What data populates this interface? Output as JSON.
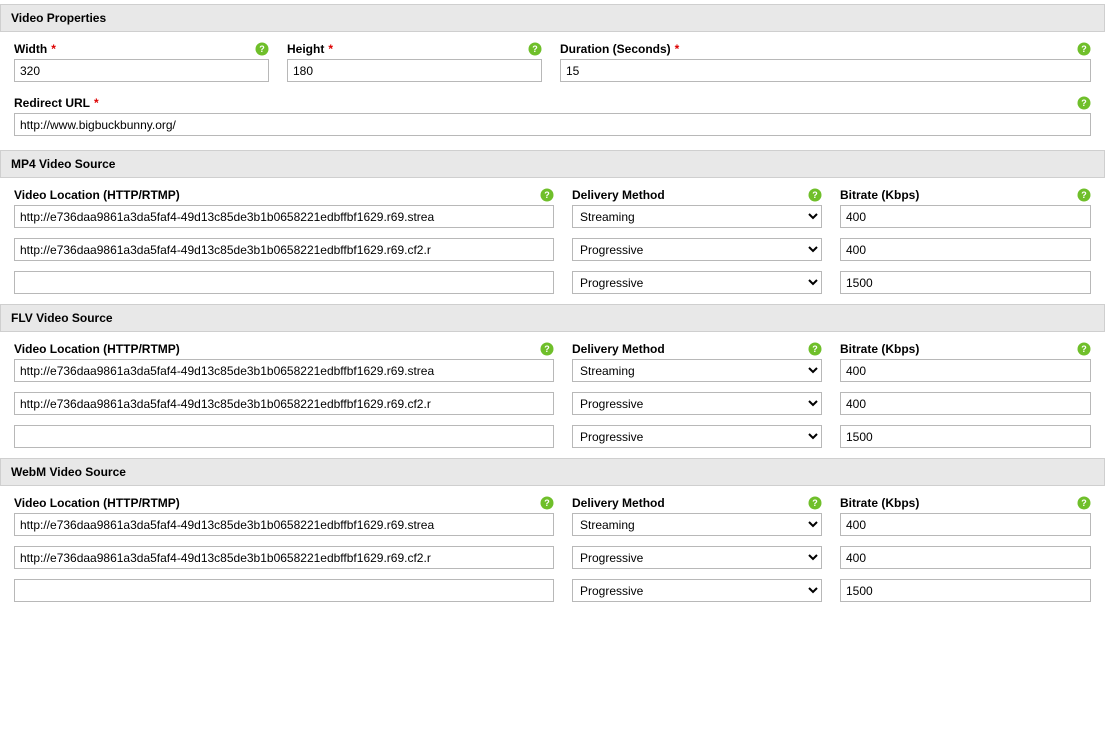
{
  "icons": {
    "help": "help-icon"
  },
  "sections": {
    "video_properties": {
      "title": "Video Properties",
      "width": {
        "label": "Width",
        "required": true,
        "value": "320"
      },
      "height": {
        "label": "Height",
        "required": true,
        "value": "180"
      },
      "duration": {
        "label": "Duration (Seconds)",
        "required": true,
        "value": "15"
      },
      "redirect": {
        "label": "Redirect URL",
        "required": true,
        "value": "http://www.bigbuckbunny.org/"
      }
    },
    "mp4": {
      "title": "MP4 Video Source"
    },
    "flv": {
      "title": "FLV Video Source"
    },
    "webm": {
      "title": "WebM Video Source"
    }
  },
  "source_labels": {
    "location": "Video Location (HTTP/RTMP)",
    "method": "Delivery Method",
    "bitrate": "Bitrate (Kbps)"
  },
  "delivery_options": [
    "Streaming",
    "Progressive"
  ],
  "source_rows": {
    "mp4": [
      {
        "location": "http://e736daa9861a3da5faf4-49d13c85de3b1b0658221edbffbf1629.r69.strea",
        "method": "Streaming",
        "bitrate": "400"
      },
      {
        "location": "http://e736daa9861a3da5faf4-49d13c85de3b1b0658221edbffbf1629.r69.cf2.r",
        "method": "Progressive",
        "bitrate": "400"
      },
      {
        "location": "",
        "method": "Progressive",
        "bitrate": "1500"
      }
    ],
    "flv": [
      {
        "location": "http://e736daa9861a3da5faf4-49d13c85de3b1b0658221edbffbf1629.r69.strea",
        "method": "Streaming",
        "bitrate": "400"
      },
      {
        "location": "http://e736daa9861a3da5faf4-49d13c85de3b1b0658221edbffbf1629.r69.cf2.r",
        "method": "Progressive",
        "bitrate": "400"
      },
      {
        "location": "",
        "method": "Progressive",
        "bitrate": "1500"
      }
    ],
    "webm": [
      {
        "location": "http://e736daa9861a3da5faf4-49d13c85de3b1b0658221edbffbf1629.r69.strea",
        "method": "Streaming",
        "bitrate": "400"
      },
      {
        "location": "http://e736daa9861a3da5faf4-49d13c85de3b1b0658221edbffbf1629.r69.cf2.r",
        "method": "Progressive",
        "bitrate": "400"
      },
      {
        "location": "",
        "method": "Progressive",
        "bitrate": "1500"
      }
    ]
  }
}
